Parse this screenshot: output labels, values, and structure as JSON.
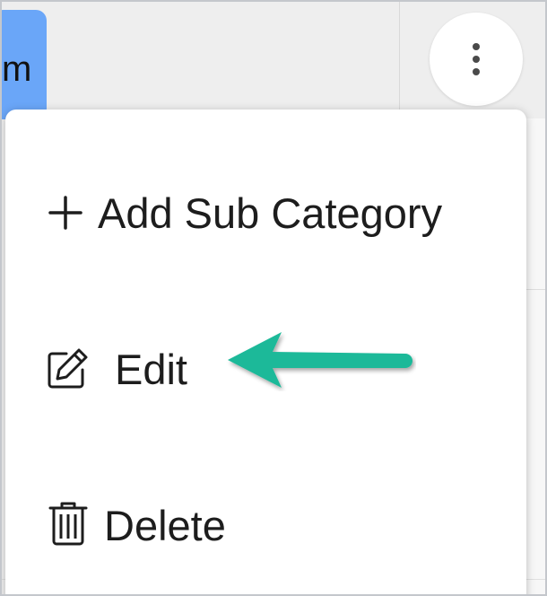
{
  "background": {
    "partial_button_label": "m"
  },
  "menu": {
    "items": [
      {
        "id": "add-sub-category",
        "icon": "plus-icon",
        "label": "Add Sub Category"
      },
      {
        "id": "edit",
        "icon": "edit-icon",
        "label": "Edit"
      },
      {
        "id": "delete",
        "icon": "trash-icon",
        "label": "Delete"
      }
    ]
  },
  "kebab_icon": "more-vertical-icon",
  "colors": {
    "accent_blue": "#6aa6f8",
    "arrow_teal": "#1cb999",
    "text": "#1d1d1d"
  }
}
